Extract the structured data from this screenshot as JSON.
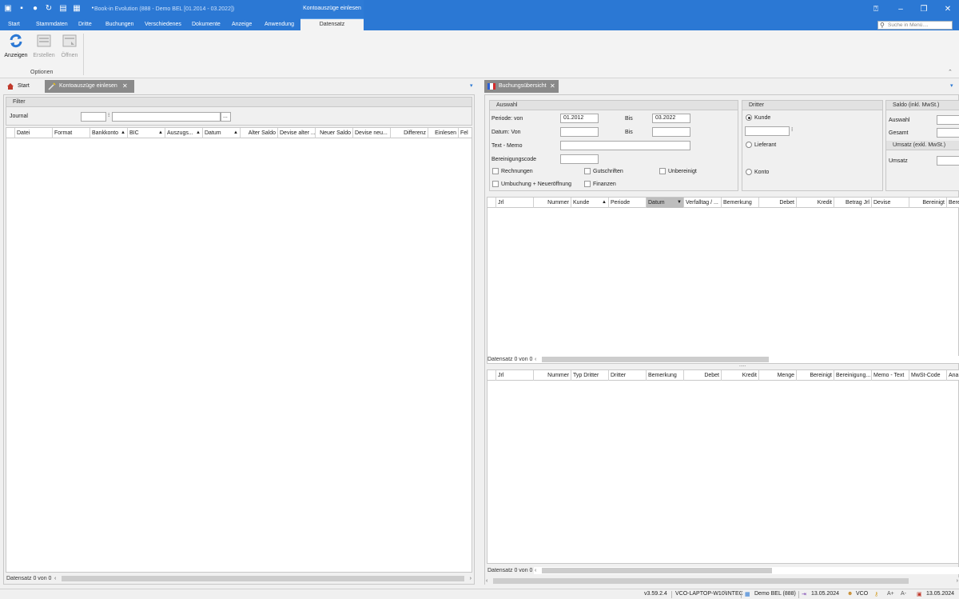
{
  "titlebar": {
    "title": "Book-in Evolution (888 - Demo BEL [01.2014 - 03.2022])",
    "context_tab": "Kontoauszüge einlesen",
    "accent": "#2b78d4"
  },
  "menu": {
    "items": [
      "Start",
      "Stammdaten",
      "Dritte",
      "Buchungen",
      "Verschiedenes",
      "Dokumente",
      "Anzeige",
      "Anwendung"
    ],
    "active": "Datensatz",
    "search_placeholder": "Suche in Menü...."
  },
  "ribbon": {
    "buttons": [
      "Anzeigen",
      "Erstellen",
      "Öffnen"
    ],
    "group_label": "Optionen"
  },
  "left": {
    "tabs": [
      "Start",
      "Kontoauszüge einlesen"
    ],
    "filter_title": "Filter",
    "journal_label": "Journal",
    "ellipsis": "...",
    "columns": [
      "Datei",
      "Format",
      "Bankkonto",
      "BIC",
      "Auszugs...",
      "Datum",
      "Alter Saldo",
      "Devise alter ...",
      "Neuer Saldo",
      "Devise neu...",
      "Differenz",
      "Einlesen",
      "Fel"
    ],
    "status": "Datensatz 0 von 0"
  },
  "right": {
    "tab": "Buchungsübersicht",
    "auswahl": {
      "title": "Auswahl",
      "periode_von_label": "Periode: von",
      "periode_von": "01.2012",
      "bis_label": "Bis",
      "periode_bis": "03.2022",
      "datum_von_label": "Datum: Von",
      "datum_bis_label": "Bis",
      "text_memo_label": "Text - Memo",
      "bereinigung_label": "Bereinigungscode",
      "checks": [
        "Rechnungen",
        "Gutschriften",
        "Unbereinigt",
        "Umbuchung + Neueröffnung",
        "Finanzen"
      ]
    },
    "dritter": {
      "title": "Dritter",
      "options": [
        "Kunde",
        "Lieferant",
        "Konto"
      ],
      "selected": "Kunde"
    },
    "saldo": {
      "title": "Saldo (inkl. MwSt.)",
      "rows": [
        "Auswahl",
        "Gesamt"
      ],
      "umsatz_title": "Umsatz (exkl. MwSt.)",
      "umsatz_label": "Umsatz"
    },
    "grid1": {
      "columns": [
        "Jrl",
        "Nummer",
        "Kunde",
        "Periode",
        "Datum",
        "Verfalltag / ...",
        "Bemerkung",
        "Debet",
        "Kredit",
        "Betrag Jrl",
        "Devise",
        "Bereinigt",
        "Berei"
      ],
      "status": "Datensatz 0 von 0"
    },
    "splitter": ".....",
    "grid2": {
      "columns": [
        "Jrl",
        "Nummer",
        "Typ Dritter",
        "Dritter",
        "Bemerkung",
        "Debet",
        "Kredit",
        "Menge",
        "Bereinigt",
        "Bereinigung...",
        "Memo - Text",
        "MwSt-Code",
        "Anal"
      ],
      "status": "Datensatz 0 von 0"
    }
  },
  "statusbar": {
    "version": "v3.59.2.4",
    "machine": "VCO-LAPTOP-W10\\INTEC",
    "company": "Demo BEL (888)",
    "date1": "13.05.2024",
    "user": "VCO",
    "font_up": "A+",
    "font_down": "A-",
    "date2": "13.05.2024"
  }
}
